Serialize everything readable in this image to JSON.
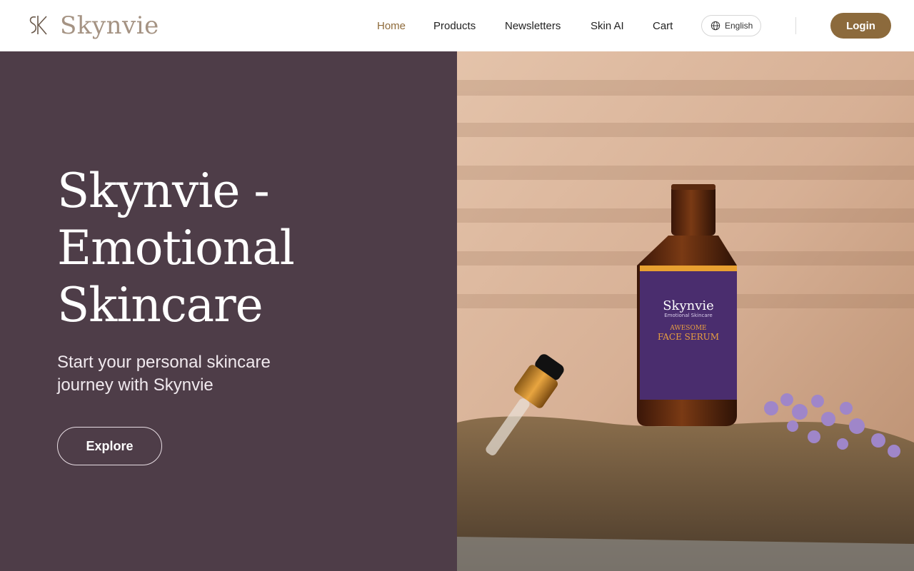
{
  "brand": {
    "name": "Skynvie"
  },
  "nav": {
    "items": [
      {
        "label": "Home",
        "active": true
      },
      {
        "label": "Products",
        "active": false
      },
      {
        "label": "Newsletters",
        "active": false
      },
      {
        "label": "Skin AI",
        "active": false
      },
      {
        "label": "Cart",
        "active": false
      }
    ],
    "language": "English",
    "login_label": "Login"
  },
  "hero": {
    "title_lines": [
      "Skynvie -",
      "Emotional",
      "Skincare"
    ],
    "subtitle": "Start your personal skincare journey with Skynvie",
    "cta_label": "Explore"
  },
  "product_image": {
    "label_brand": "Skynvie",
    "label_tagline": "Emotional Skincare",
    "label_line1": "AWESOME",
    "label_line2": "FACE SERUM"
  },
  "colors": {
    "accent": "#8c6a3c",
    "hero_bg": "#4e3d48",
    "nav_active": "#8e6a3a",
    "logo_text": "#a59383"
  }
}
